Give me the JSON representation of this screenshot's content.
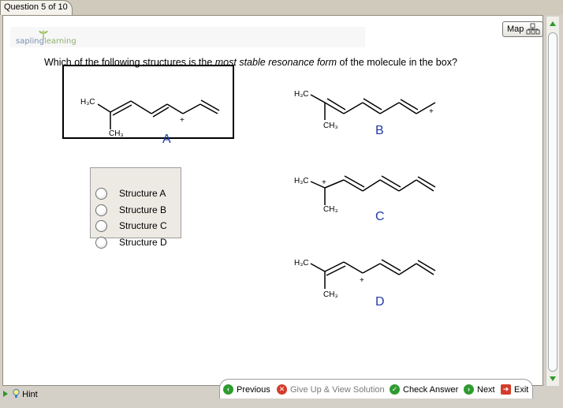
{
  "tab": {
    "label": "Question 5 of 10"
  },
  "logo": {
    "part1": "sapling",
    "part2": "learning"
  },
  "map_button": {
    "label": "Map"
  },
  "question": {
    "prefix": "Which of the following structures is the ",
    "emphasis": "most stable resonance form",
    "suffix": " of the molecule in the box?"
  },
  "structures": {
    "A": {
      "label": "A",
      "h3c": "H₃C",
      "ch3": "CH₃",
      "charge": "+"
    },
    "B": {
      "label": "B",
      "h3c": "H₃C",
      "ch3": "CH₃",
      "charge": "+"
    },
    "C": {
      "label": "C",
      "h3c": "H₃C",
      "ch3": "CH₃",
      "charge": "+"
    },
    "D": {
      "label": "D",
      "h3c": "H₃C",
      "ch3": "CH₃",
      "charge": "+"
    }
  },
  "options": [
    {
      "label": "Structure A"
    },
    {
      "label": "Structure B"
    },
    {
      "label": "Structure C"
    },
    {
      "label": "Structure D"
    }
  ],
  "hint": {
    "label": "Hint"
  },
  "nav": {
    "previous": "Previous",
    "give_up": "Give Up & View Solution",
    "check": "Check Answer",
    "next": "Next",
    "exit": "Exit"
  },
  "colors": {
    "label_blue": "#1f3aa8",
    "nav_green": "#2f9b2f",
    "nav_red": "#d43c2c"
  }
}
